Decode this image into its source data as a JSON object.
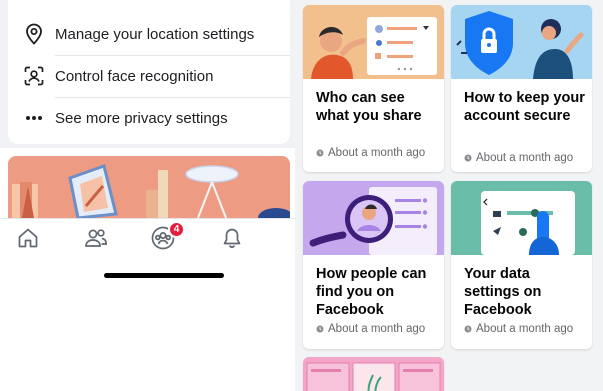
{
  "privacy_menu": {
    "items": [
      {
        "label": "Manage your location settings",
        "icon": "location-pin-icon"
      },
      {
        "label": "Control face recognition",
        "icon": "face-scan-icon"
      },
      {
        "label": "See more privacy settings",
        "icon": "more-dots-icon"
      }
    ]
  },
  "bottom_nav": {
    "items": [
      {
        "icon": "home-icon"
      },
      {
        "icon": "friends-icon"
      },
      {
        "icon": "groups-icon"
      },
      {
        "icon": "bell-icon"
      }
    ],
    "badge_count": "4"
  },
  "topics": [
    {
      "title": "Who can see what you share",
      "meta": "About a month ago",
      "art_color": "#f2c08d"
    },
    {
      "title": "How to keep your account secure",
      "meta": "About a month ago",
      "art_color": "#a6d5f2"
    },
    {
      "title": "How people can find you on Facebook",
      "meta": "About a month ago",
      "art_color": "#c5a7ee"
    },
    {
      "title": "Your data settings on Facebook",
      "meta": "About a month ago",
      "art_color": "#6abda8"
    }
  ],
  "colors": {
    "brand_blue": "#1877f2",
    "badge_red": "#e41e3f",
    "meta_gray": "#65676b"
  }
}
